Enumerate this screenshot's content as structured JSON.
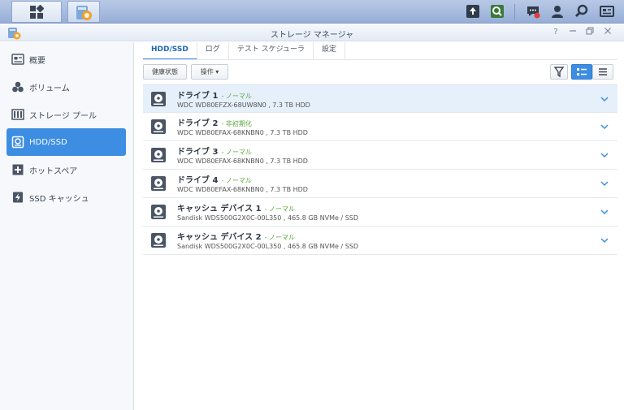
{
  "window": {
    "title": "ストレージ マネージャ",
    "help": "?"
  },
  "sidebar": {
    "items": [
      {
        "label": "概要",
        "icon": "overview-icon"
      },
      {
        "label": "ボリューム",
        "icon": "volume-icon"
      },
      {
        "label": "ストレージ プール",
        "icon": "storage-pool-icon"
      },
      {
        "label": "HDD/SSD",
        "icon": "disk-icon",
        "active": true
      },
      {
        "label": "ホットスペア",
        "icon": "hot-spare-icon"
      },
      {
        "label": "SSD キャッシュ",
        "icon": "ssd-cache-icon"
      }
    ]
  },
  "tabs": [
    {
      "label": "HDD/SSD",
      "active": true
    },
    {
      "label": "ログ"
    },
    {
      "label": "テスト スケジューラ"
    },
    {
      "label": "設定"
    }
  ],
  "toolbar": {
    "health_label": "健康状態",
    "action_label": "操作 ▾"
  },
  "drives": [
    {
      "name": "ドライブ 1",
      "status": "- ノーマル",
      "model": "WDC WD80EFZX-68UW8N0 , 7.3 TB HDD"
    },
    {
      "name": "ドライブ 2",
      "status": "- 非初期化",
      "model": "WDC WD80EFAX-68KNBN0 , 7.3 TB HDD"
    },
    {
      "name": "ドライブ 3",
      "status": "- ノーマル",
      "model": "WDC WD80EFAX-68KNBN0 , 7.3 TB HDD"
    },
    {
      "name": "ドライブ 4",
      "status": "- ノーマル",
      "model": "WDC WD80EFAX-68KNBN0 , 7.3 TB HDD"
    },
    {
      "name": "キャッシュ デバイス 1",
      "status": "- ノーマル",
      "model": "Sandisk WDS500G2X0C-00L350 , 465.8 GB NVMe / SSD"
    },
    {
      "name": "キャッシュ デバイス 2",
      "status": "- ノーマル",
      "model": "Sandisk WDS500G2X0C-00L350 , 465.8 GB NVMe / SSD"
    }
  ],
  "colors": {
    "accent": "#3d8ee2",
    "status_ok": "#5aa83c",
    "selected_row": "#e5f0fb"
  }
}
